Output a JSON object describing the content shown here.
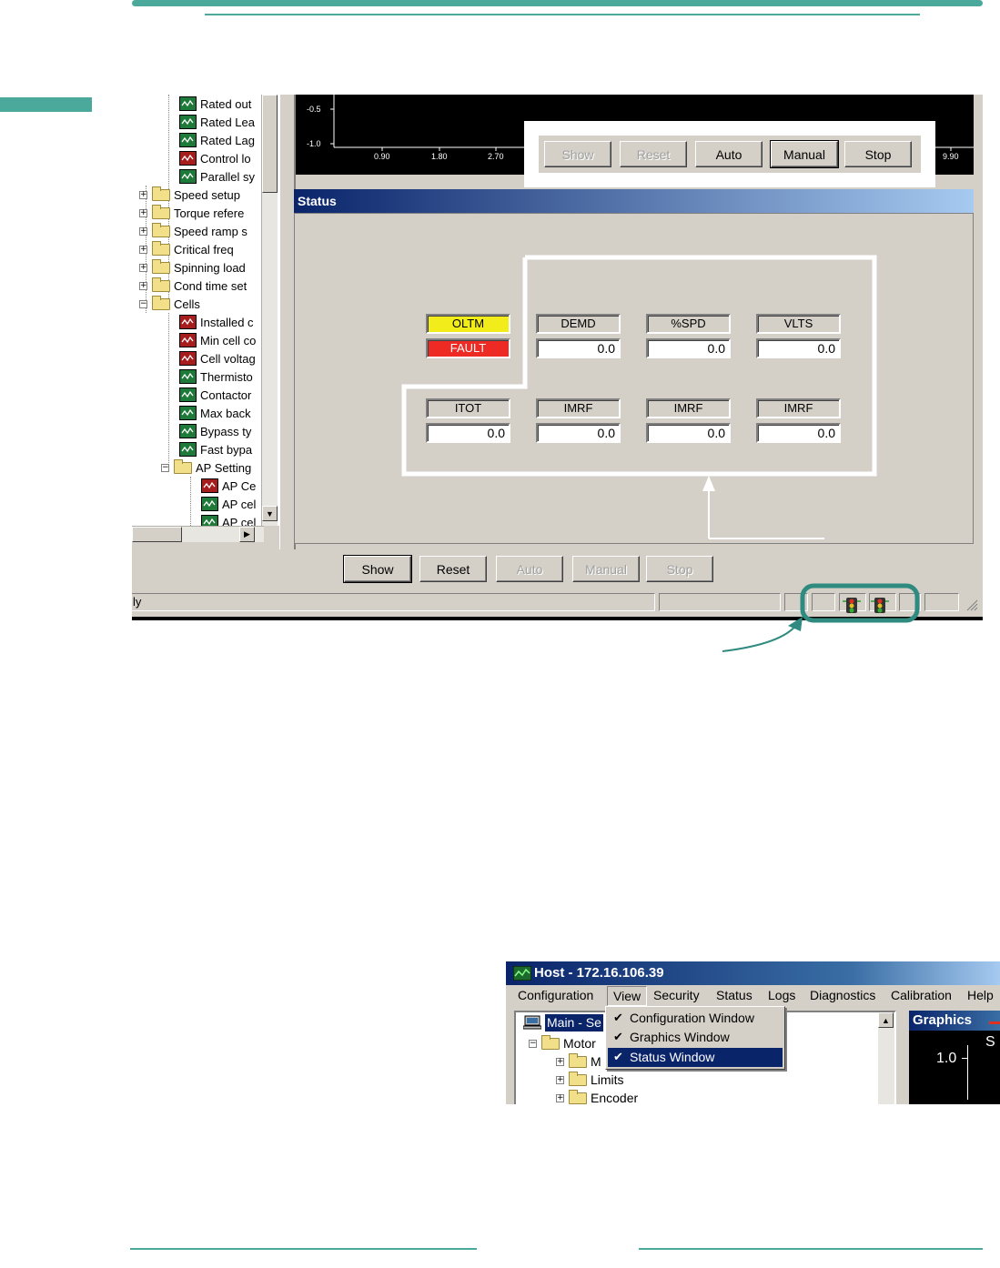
{
  "main_window": {
    "tree": {
      "items": [
        {
          "label": "Rated out",
          "icon": "parameter-green-icon"
        },
        {
          "label": "Rated Lea",
          "icon": "parameter-green-icon"
        },
        {
          "label": "Rated Lag",
          "icon": "parameter-green-icon"
        },
        {
          "label": "Control lo",
          "icon": "parameter-red-icon"
        },
        {
          "label": "Parallel sy",
          "icon": "parameter-green-icon"
        },
        {
          "label": "Speed setup",
          "icon": "folder-icon"
        },
        {
          "label": "Torque refere",
          "icon": "folder-icon"
        },
        {
          "label": "Speed ramp s",
          "icon": "folder-icon"
        },
        {
          "label": "Critical freq",
          "icon": "folder-icon"
        },
        {
          "label": "Spinning load",
          "icon": "folder-icon"
        },
        {
          "label": "Cond time set",
          "icon": "folder-icon"
        },
        {
          "label": "Cells",
          "icon": "folder-open-icon"
        },
        {
          "label": "Installed c",
          "icon": "parameter-red-icon"
        },
        {
          "label": "Min cell co",
          "icon": "parameter-red-icon"
        },
        {
          "label": "Cell voltag",
          "icon": "parameter-red-icon"
        },
        {
          "label": "Thermisto",
          "icon": "parameter-green-icon"
        },
        {
          "label": "Contactor",
          "icon": "parameter-green-icon"
        },
        {
          "label": "Max back",
          "icon": "parameter-green-icon"
        },
        {
          "label": "Bypass ty",
          "icon": "parameter-green-icon"
        },
        {
          "label": "Fast bypa",
          "icon": "parameter-green-icon"
        },
        {
          "label": "AP Setting",
          "icon": "folder-open-icon"
        },
        {
          "label": "AP Ce",
          "icon": "parameter-red-icon"
        },
        {
          "label": "AP cel",
          "icon": "parameter-green-icon"
        },
        {
          "label": "AP cel",
          "icon": "parameter-green-icon"
        }
      ]
    },
    "graph": {
      "y_ticks": [
        "-0.5",
        "-1.0"
      ],
      "x_ticks": [
        "0.90",
        "1.80",
        "2.70",
        "9.90"
      ]
    },
    "callout_buttons": {
      "show": "Show",
      "reset": "Reset",
      "auto": "Auto",
      "manual": "Manual",
      "stop": "Stop"
    },
    "status_window": {
      "title": "Status",
      "indicators": {
        "oltm": "OLTM",
        "fault": "FAULT"
      },
      "row1": [
        {
          "label": "DEMD",
          "value": "0.0"
        },
        {
          "label": "%SPD",
          "value": "0.0"
        },
        {
          "label": "VLTS",
          "value": "0.0"
        }
      ],
      "row2": [
        {
          "label": "ITOT",
          "value": "0.0"
        },
        {
          "label": "IMRF",
          "value": "0.0"
        },
        {
          "label": "IMRF",
          "value": "0.0"
        },
        {
          "label": "IMRF",
          "value": "0.0"
        }
      ]
    },
    "bottom_buttons": {
      "show": "Show",
      "reset": "Reset",
      "auto": "Auto",
      "manual": "Manual",
      "stop": "Stop"
    },
    "statusbar": {
      "text": "ly"
    }
  },
  "host_window": {
    "title": "Host - 172.16.106.39",
    "menu": [
      "Configuration",
      "View",
      "Security",
      "Status",
      "Logs",
      "Diagnostics",
      "Calibration",
      "Help"
    ],
    "view_menu_items": [
      {
        "label": "Configuration Window",
        "checked": true
      },
      {
        "label": "Graphics Window",
        "checked": true
      },
      {
        "label": "Status Window",
        "checked": true,
        "selected": true
      }
    ],
    "tree": {
      "root": "Main - Se",
      "items": [
        "Motor",
        "M",
        "Limits",
        "Encoder"
      ]
    },
    "graphics_title": "Graphics",
    "graphics_y_tick": "1.0",
    "graphics_partial_label": "S"
  },
  "colors": {
    "accent": "#4aa99a",
    "indicator_yellow": "#f2ec1b",
    "indicator_red": "#ee2a24",
    "title_blue": "#0a246a"
  }
}
